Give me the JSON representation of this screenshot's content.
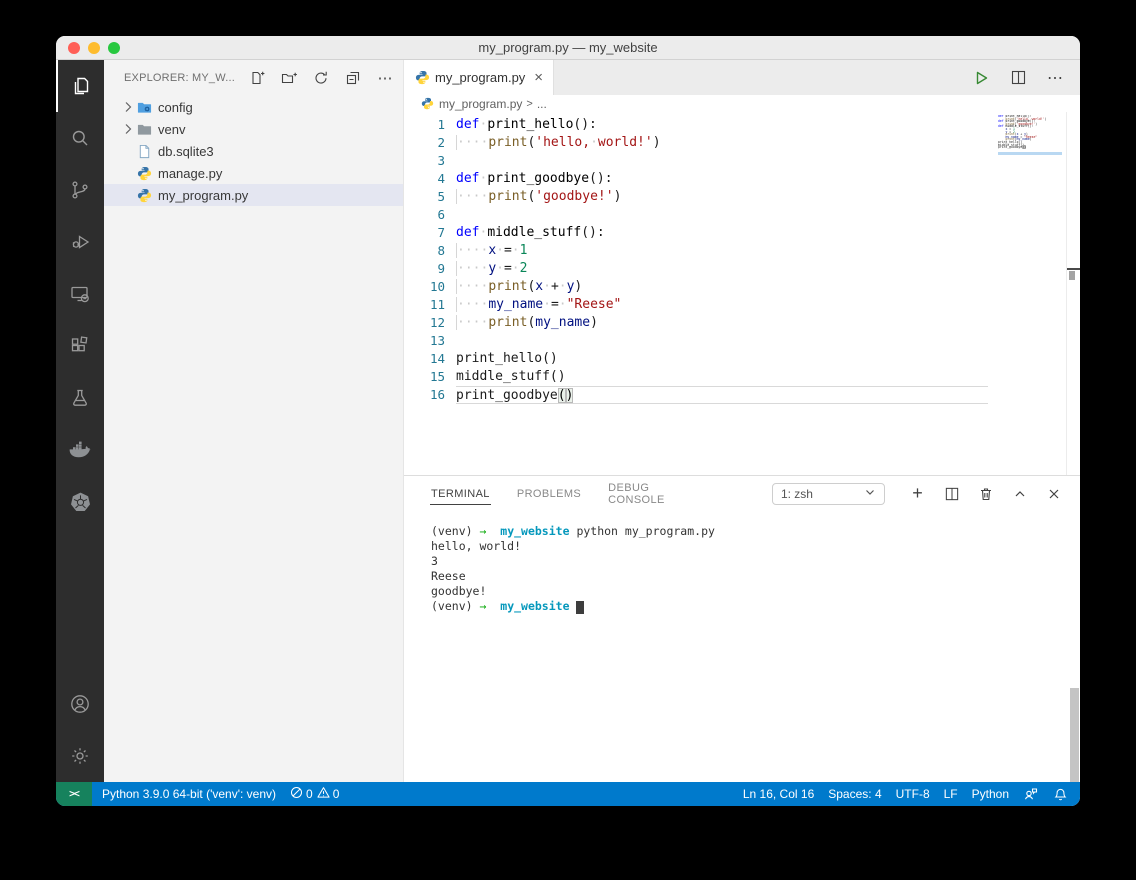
{
  "window": {
    "title": "my_program.py — my_website"
  },
  "titlebar": {
    "buttons": [
      "close",
      "minimize",
      "zoom"
    ]
  },
  "activity_bar": {
    "items": [
      {
        "name": "explorer",
        "active": true
      },
      {
        "name": "search"
      },
      {
        "name": "source-control"
      },
      {
        "name": "run-and-debug"
      },
      {
        "name": "remote-explorer"
      },
      {
        "name": "extensions"
      },
      {
        "name": "testing"
      },
      {
        "name": "docker"
      },
      {
        "name": "kubernetes"
      }
    ],
    "bottom_items": [
      {
        "name": "accounts"
      },
      {
        "name": "manage-settings"
      }
    ]
  },
  "sidebar": {
    "header": {
      "title": "EXPLORER: MY_W...",
      "actions": [
        "new-file",
        "new-folder",
        "refresh-explorer",
        "collapse-folders",
        "more-actions"
      ],
      "more_glyph": "⋯"
    },
    "files": [
      {
        "label": "config",
        "icon": "folder-config",
        "expandable": true
      },
      {
        "label": "venv",
        "icon": "folder",
        "expandable": true
      },
      {
        "label": "db.sqlite3",
        "icon": "file"
      },
      {
        "label": "manage.py",
        "icon": "python"
      },
      {
        "label": "my_program.py",
        "icon": "python",
        "selected": true
      }
    ]
  },
  "editor": {
    "tab": {
      "label": "my_program.py",
      "close_glyph": "×"
    },
    "toolbar": [
      "run-python-file",
      "split-editor",
      "more-actions"
    ],
    "toolbar_more_glyph": "⋯",
    "breadcrumb": {
      "file": "my_program.py",
      "separator": ">",
      "more": "..."
    },
    "cursor_line": 16,
    "code_lines": [
      [
        [
          "def",
          "kw"
        ],
        [
          " ",
          "ws"
        ],
        [
          "print_hello",
          "defn"
        ],
        [
          "():",
          "pl"
        ]
      ],
      [
        [
          "    ",
          "ind"
        ],
        [
          "print",
          "fn"
        ],
        [
          "(",
          "pl"
        ],
        [
          "'hello,",
          "str"
        ],
        [
          " ",
          "ws"
        ],
        [
          "world!'",
          "str"
        ],
        [
          ")",
          "pl"
        ]
      ],
      [],
      [
        [
          "def",
          "kw"
        ],
        [
          " ",
          "ws"
        ],
        [
          "print_goodbye",
          "defn"
        ],
        [
          "():",
          "pl"
        ]
      ],
      [
        [
          "    ",
          "ind"
        ],
        [
          "print",
          "fn"
        ],
        [
          "(",
          "pl"
        ],
        [
          "'goodbye!'",
          "str"
        ],
        [
          ")",
          "pl"
        ]
      ],
      [],
      [
        [
          "def",
          "kw"
        ],
        [
          " ",
          "ws"
        ],
        [
          "middle_stuff",
          "defn"
        ],
        [
          "():",
          "pl"
        ]
      ],
      [
        [
          "    ",
          "ind"
        ],
        [
          "x",
          "var"
        ],
        [
          " ",
          "ws"
        ],
        [
          "=",
          "pl"
        ],
        [
          " ",
          "ws"
        ],
        [
          "1",
          "num"
        ]
      ],
      [
        [
          "    ",
          "ind"
        ],
        [
          "y",
          "var"
        ],
        [
          " ",
          "ws"
        ],
        [
          "=",
          "pl"
        ],
        [
          " ",
          "ws"
        ],
        [
          "2",
          "num"
        ]
      ],
      [
        [
          "    ",
          "ind"
        ],
        [
          "print",
          "fn"
        ],
        [
          "(",
          "pl"
        ],
        [
          "x",
          "var"
        ],
        [
          " ",
          "ws"
        ],
        [
          "+",
          "pl"
        ],
        [
          " ",
          "ws"
        ],
        [
          "y",
          "var"
        ],
        [
          ")",
          "pl"
        ]
      ],
      [
        [
          "    ",
          "ind"
        ],
        [
          "my_name",
          "var"
        ],
        [
          " ",
          "ws"
        ],
        [
          "=",
          "pl"
        ],
        [
          " ",
          "ws"
        ],
        [
          "\"Reese\"",
          "str"
        ]
      ],
      [
        [
          "    ",
          "ind"
        ],
        [
          "print",
          "fn"
        ],
        [
          "(",
          "pl"
        ],
        [
          "my_name",
          "var"
        ],
        [
          ")",
          "pl"
        ]
      ],
      [],
      [
        [
          "print_hello",
          "pl"
        ],
        [
          "()",
          "pl"
        ]
      ],
      [
        [
          "middle_stuff",
          "pl"
        ],
        [
          "()",
          "pl"
        ]
      ],
      [
        [
          "print_goodbye",
          "pl"
        ],
        [
          "(",
          "br"
        ],
        [
          ")",
          "br"
        ]
      ]
    ]
  },
  "panel": {
    "tabs": [
      {
        "label": "TERMINAL",
        "active": true
      },
      {
        "label": "PROBLEMS",
        "active": false
      },
      {
        "label": "DEBUG CONSOLE",
        "active": false
      }
    ],
    "shell_selector": "1: zsh",
    "actions": [
      "new-terminal",
      "split-terminal",
      "kill-terminal",
      "maximize-panel",
      "close-panel"
    ],
    "plus_glyph": "+",
    "terminal_lines": [
      [
        [
          "(venv) ",
          "p"
        ],
        [
          "→",
          "arrow"
        ],
        [
          "  ",
          "p"
        ],
        [
          "my_website",
          "host"
        ],
        [
          " python my_program.py",
          "p"
        ]
      ],
      [
        [
          "hello, world!",
          "p"
        ]
      ],
      [
        [
          "3",
          "p"
        ]
      ],
      [
        [
          "Reese",
          "p"
        ]
      ],
      [
        [
          "goodbye!",
          "p"
        ]
      ],
      [
        [
          "(venv) ",
          "p"
        ],
        [
          "→",
          "arrow"
        ],
        [
          "  ",
          "p"
        ],
        [
          "my_website",
          "host"
        ],
        [
          " ",
          "p"
        ],
        [
          " ",
          "cursor"
        ]
      ]
    ]
  },
  "status_bar": {
    "remote_indicator": "><",
    "python_interpreter": "Python 3.9.0 64-bit ('venv': venv)",
    "errors": "0",
    "warnings": "0",
    "cursor_position": "Ln 16, Col 16",
    "indentation": "Spaces: 4",
    "encoding": "UTF-8",
    "eol": "LF",
    "language_mode": "Python"
  },
  "colors": {
    "statusbar": "#007acc",
    "remote_section": "#16825d",
    "activitybar": "#2d2d2d",
    "sidebar_bg": "#f3f3f3",
    "selected_row": "#e4e6f1",
    "tab_active": "#ffffff",
    "run_button": "#388a34",
    "keyword": "#0000ff",
    "builtin_function": "#795e26",
    "string": "#a31515",
    "number": "#098658",
    "variable": "#001080",
    "terminal_host": "#0598bc",
    "prompt_arrow": "#00a600"
  }
}
